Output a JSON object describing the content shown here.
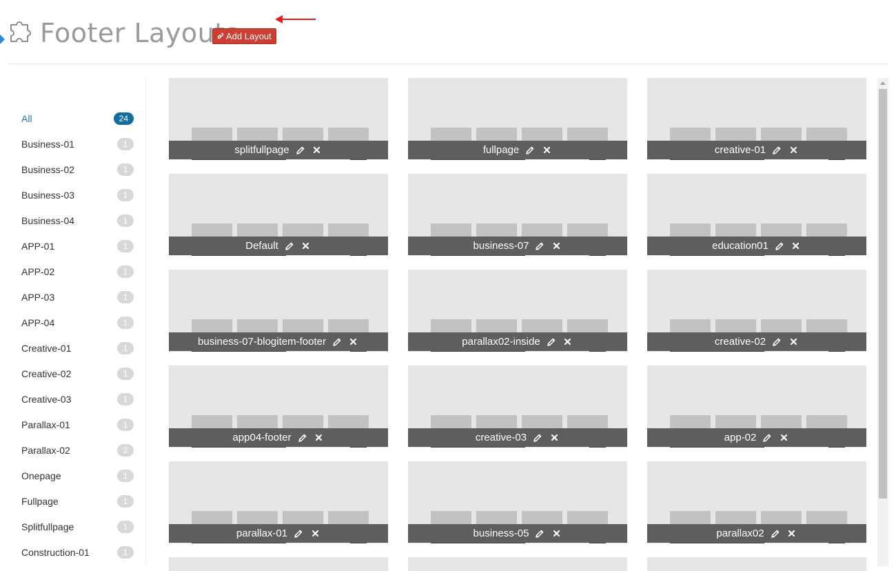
{
  "header": {
    "title": "Footer Layouts",
    "add_button_label": "Add Layout",
    "icon": "puzzle-icon"
  },
  "colors": {
    "accent_red": "#cd3f33",
    "active_blue": "#1f73b7",
    "badge_active": "#0f6e9e"
  },
  "sidebar": {
    "items": [
      {
        "label": "All",
        "count": "24",
        "active": true
      },
      {
        "label": "Business-01",
        "count": "1"
      },
      {
        "label": "Business-02",
        "count": "1"
      },
      {
        "label": "Business-03",
        "count": "1"
      },
      {
        "label": "Business-04",
        "count": "1"
      },
      {
        "label": "APP-01",
        "count": "1"
      },
      {
        "label": "APP-02",
        "count": "1"
      },
      {
        "label": "APP-03",
        "count": "1"
      },
      {
        "label": "APP-04",
        "count": "1"
      },
      {
        "label": "Creative-01",
        "count": "1"
      },
      {
        "label": "Creative-02",
        "count": "1"
      },
      {
        "label": "Creative-03",
        "count": "1"
      },
      {
        "label": "Parallax-01",
        "count": "1"
      },
      {
        "label": "Parallax-02",
        "count": "2"
      },
      {
        "label": "Onepage",
        "count": "1"
      },
      {
        "label": "Fullpage",
        "count": "1"
      },
      {
        "label": "Splitfullpage",
        "count": "1"
      },
      {
        "label": "Construction-01",
        "count": "1"
      }
    ]
  },
  "layouts": [
    {
      "name": "splitfullpage"
    },
    {
      "name": "fullpage"
    },
    {
      "name": "creative-01"
    },
    {
      "name": "Default"
    },
    {
      "name": "business-07"
    },
    {
      "name": "education01"
    },
    {
      "name": "business-07-blogitem-footer"
    },
    {
      "name": "parallax02-inside"
    },
    {
      "name": "creative-02"
    },
    {
      "name": "app04-footer"
    },
    {
      "name": "creative-03"
    },
    {
      "name": "app-02"
    },
    {
      "name": "parallax-01"
    },
    {
      "name": "business-05"
    },
    {
      "name": "parallax02"
    }
  ],
  "icons": {
    "edit": "pencil-icon",
    "delete": "close-icon",
    "add": "link-icon"
  }
}
